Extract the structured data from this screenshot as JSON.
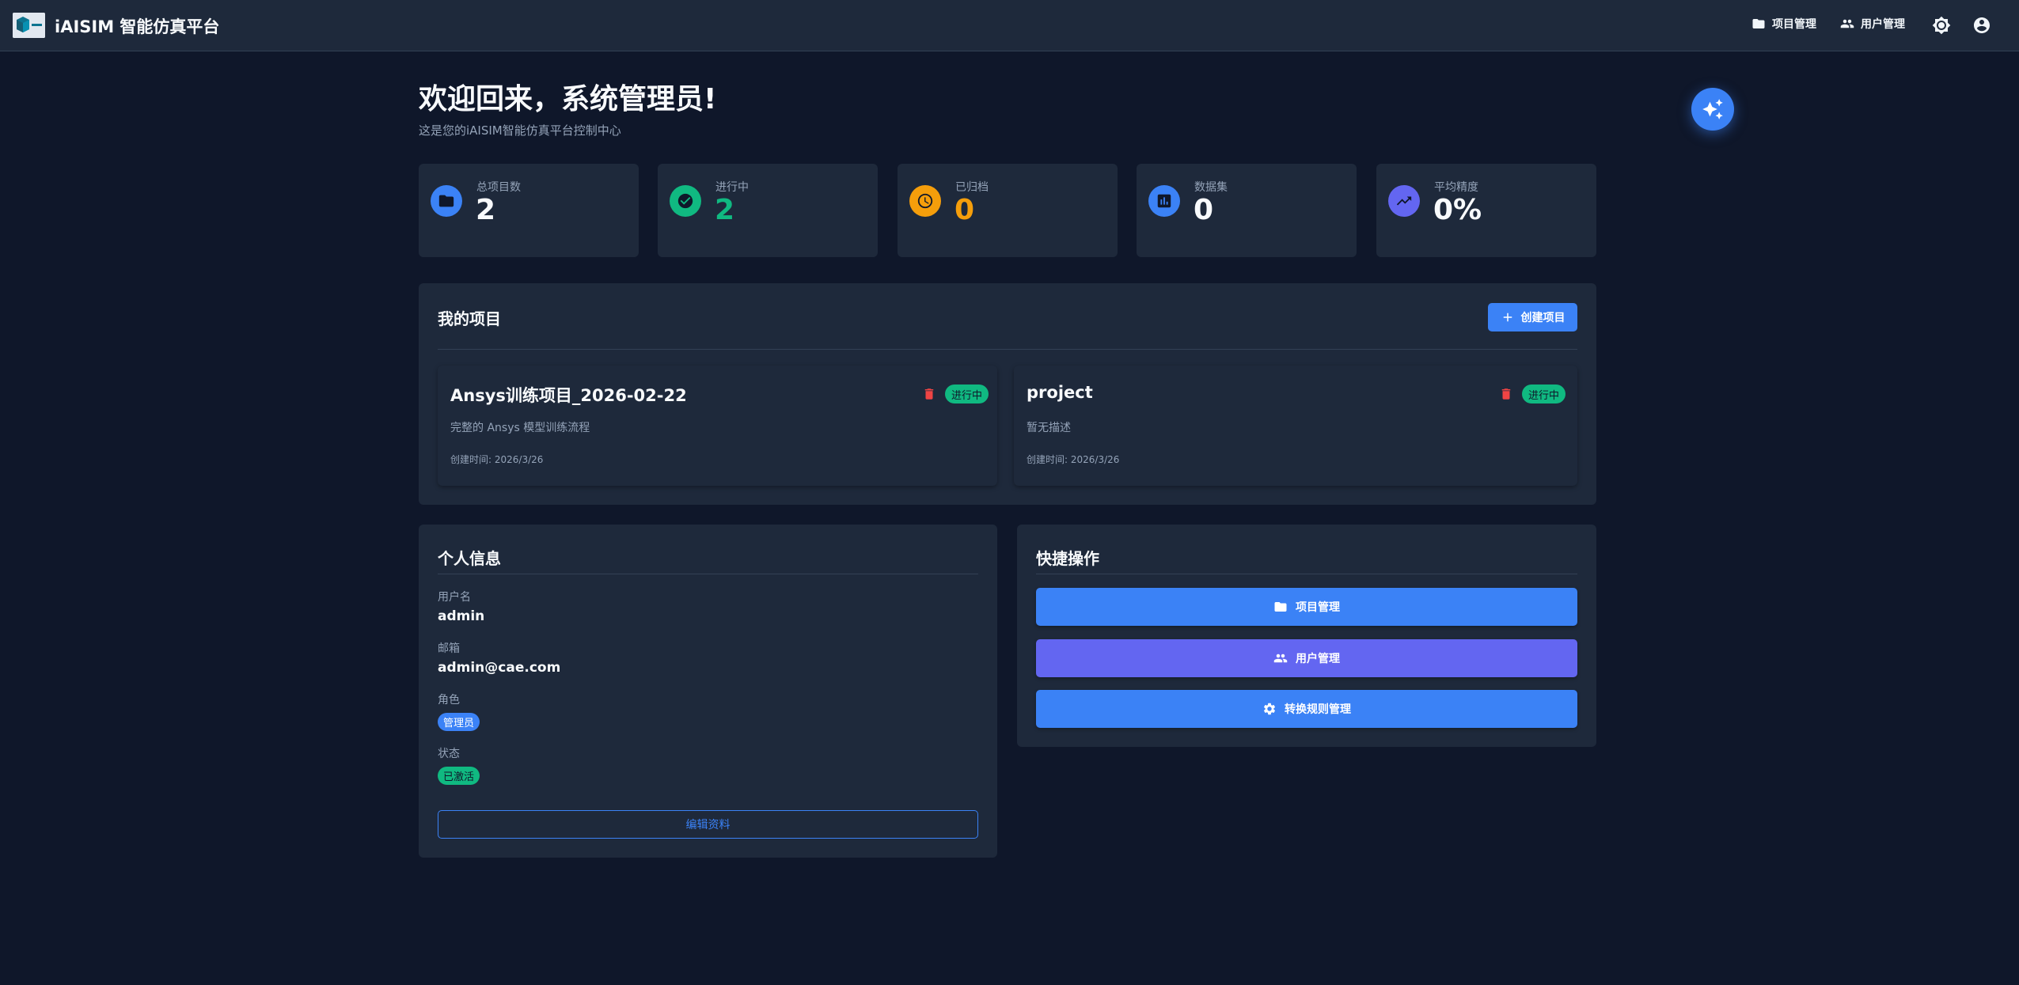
{
  "header": {
    "app_title": "iAISIM 智能仿真平台",
    "nav": {
      "projects": "项目管理",
      "users": "用户管理"
    }
  },
  "welcome": {
    "title": "欢迎回来，系统管理员!",
    "subtitle": "这是您的iAISIM智能仿真平台控制中心"
  },
  "stats": [
    {
      "label": "总项目数",
      "value": "2",
      "color": "#3b82f6",
      "icon": "folder-icon"
    },
    {
      "label": "进行中",
      "value": "2",
      "color": "#10b981",
      "icon": "check-circle-icon"
    },
    {
      "label": "已归档",
      "value": "0",
      "color": "#f59e0b",
      "icon": "clock-icon"
    },
    {
      "label": "数据集",
      "value": "0",
      "color": "#3b82f6",
      "icon": "bar-chart-icon"
    },
    {
      "label": "平均精度",
      "value": "0%",
      "color": "#6366f1",
      "icon": "trending-up-icon"
    }
  ],
  "projects_panel": {
    "title": "我的项目",
    "create_label": "创建项目",
    "items": [
      {
        "name": "Ansys训练项目_2026-02-22",
        "description": "完整的 Ansys 模型训练流程",
        "created": "创建时间: 2026/3/26",
        "status": "进行中"
      },
      {
        "name": "project",
        "description": "暂无描述",
        "created": "创建时间: 2026/3/26",
        "status": "进行中"
      }
    ]
  },
  "profile": {
    "title": "个人信息",
    "username_label": "用户名",
    "username": "admin",
    "email_label": "邮箱",
    "email": "admin@cae.com",
    "role_label": "角色",
    "role": "管理员",
    "status_label": "状态",
    "status": "已激活",
    "edit_label": "编辑资料"
  },
  "quick_actions": {
    "title": "快捷操作",
    "items": [
      {
        "label": "项目管理",
        "color": "#3b82f6",
        "icon": "folder-icon"
      },
      {
        "label": "用户管理",
        "color": "#6366f1",
        "icon": "users-icon"
      },
      {
        "label": "转换规则管理",
        "color": "#3b82f6",
        "icon": "gear-icon"
      }
    ]
  },
  "colors": {
    "background": "#0f172a",
    "surface": "#1e293b",
    "primary": "#3b82f6",
    "success": "#10b981",
    "warning": "#f59e0b",
    "indigo": "#6366f1",
    "danger": "#ef4444"
  }
}
